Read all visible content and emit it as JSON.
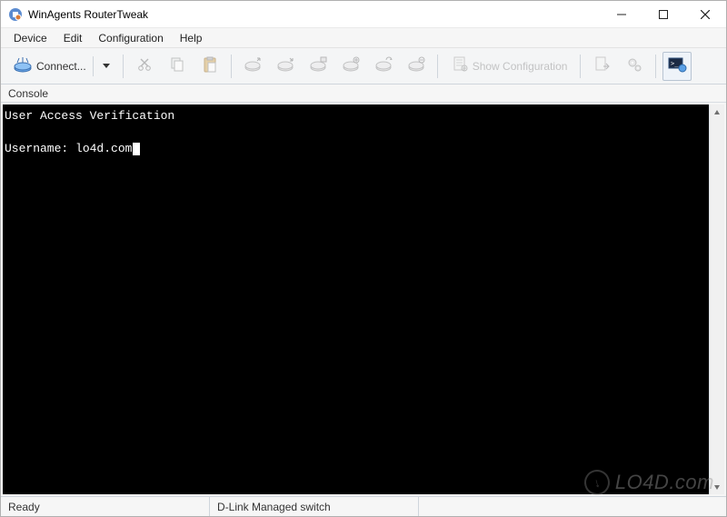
{
  "titlebar": {
    "title": "WinAgents RouterTweak"
  },
  "menu": {
    "items": [
      "Device",
      "Edit",
      "Configuration",
      "Help"
    ]
  },
  "toolbar": {
    "connect_label": "Connect...",
    "show_config_label": "Show Configuration"
  },
  "tab": {
    "label": "Console"
  },
  "console": {
    "line1": "User Access Verification",
    "prompt_label": "Username: ",
    "input_value": "lo4d.com"
  },
  "statusbar": {
    "left": "Ready",
    "center": "D-Link Managed switch",
    "right": ""
  },
  "watermark": {
    "text": "LO4D.com"
  }
}
